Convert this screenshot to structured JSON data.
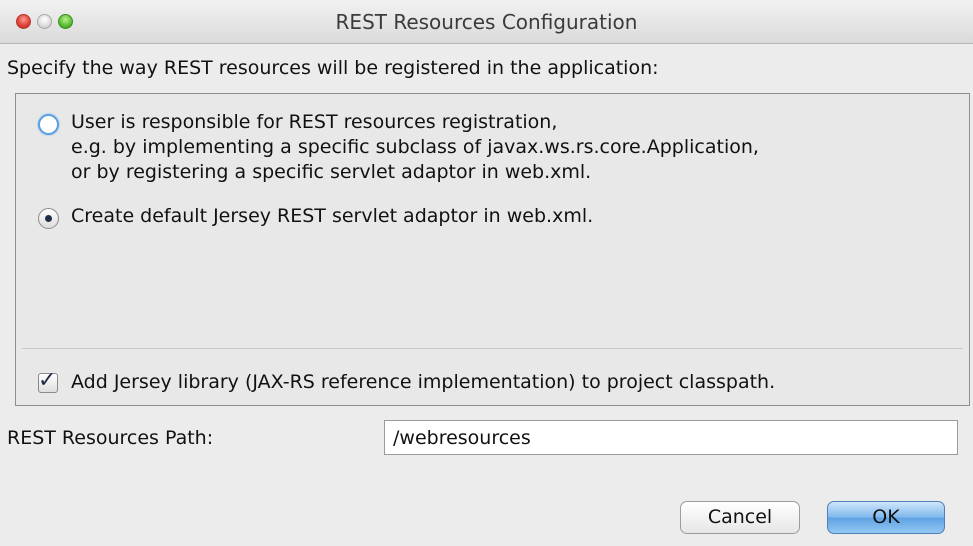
{
  "window": {
    "title": "REST Resources Configuration"
  },
  "instruction": "Specify the way REST resources will be registered in the application:",
  "options": [
    {
      "lines": [
        "User is responsible for REST resources registration,",
        "e.g. by implementing a specific subclass of javax.ws.rs.core.Application,",
        "or by registering a specific servlet adaptor in web.xml."
      ],
      "selected": false
    },
    {
      "lines": [
        "Create default Jersey REST servlet adaptor in web.xml."
      ],
      "selected": true
    }
  ],
  "add_library": {
    "label": "Add Jersey library (JAX-RS reference implementation) to project classpath.",
    "checked": true
  },
  "path": {
    "label": "REST Resources Path:",
    "value": "/webresources"
  },
  "buttons": {
    "cancel": "Cancel",
    "ok": "OK"
  }
}
